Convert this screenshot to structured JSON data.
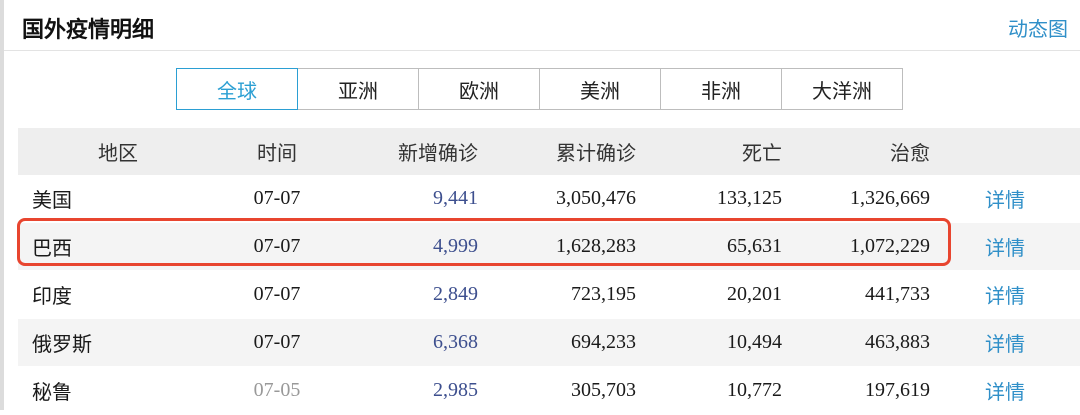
{
  "header": {
    "title": "国外疫情明细",
    "link": "动态图"
  },
  "tabs": [
    {
      "label": "全球",
      "active": true
    },
    {
      "label": "亚洲",
      "active": false
    },
    {
      "label": "欧洲",
      "active": false
    },
    {
      "label": "美洲",
      "active": false
    },
    {
      "label": "非洲",
      "active": false
    },
    {
      "label": "大洋洲",
      "active": false
    }
  ],
  "table": {
    "columns": {
      "region": "地区",
      "time": "时间",
      "new": "新增确诊",
      "total": "累计确诊",
      "deaths": "死亡",
      "recovered": "治愈"
    },
    "rows": [
      {
        "region": "美国",
        "time": "07-07",
        "new": "9,441",
        "total": "3,050,476",
        "deaths": "133,125",
        "recovered": "1,326,669",
        "detail": "详情"
      },
      {
        "region": "巴西",
        "time": "07-07",
        "new": "4,999",
        "total": "1,628,283",
        "deaths": "65,631",
        "recovered": "1,072,229",
        "detail": "详情"
      },
      {
        "region": "印度",
        "time": "07-07",
        "new": "2,849",
        "total": "723,195",
        "deaths": "20,201",
        "recovered": "441,733",
        "detail": "详情"
      },
      {
        "region": "俄罗斯",
        "time": "07-07",
        "new": "6,368",
        "total": "694,233",
        "deaths": "10,494",
        "recovered": "463,883",
        "detail": "详情"
      },
      {
        "region": "秘鲁",
        "time": "07-05",
        "new": "2,985",
        "total": "305,703",
        "deaths": "10,772",
        "recovered": "197,619",
        "detail": "详情"
      }
    ]
  },
  "colors": {
    "accent": "#2b9fd3",
    "link": "#2f8fc8",
    "new_cases": "#3d4f8e",
    "highlight": "#e8452f",
    "header_bg": "#eeeeee",
    "stripe": "#f4f4f4"
  }
}
